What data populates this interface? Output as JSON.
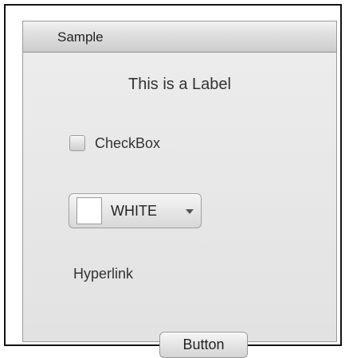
{
  "panel": {
    "title": "Sample"
  },
  "label": {
    "text": "This is a Label"
  },
  "checkbox": {
    "label": "CheckBox",
    "checked": false
  },
  "color_picker": {
    "value_label": "WHITE",
    "swatch_color": "#ffffff",
    "arrow_icon": "chevron-down-icon"
  },
  "hyperlink": {
    "text": "Hyperlink"
  },
  "button": {
    "label": "Button"
  },
  "colors": {
    "panel_background": "#e8e8e8",
    "titlebar_background": "#dedede",
    "text": "#333333"
  }
}
